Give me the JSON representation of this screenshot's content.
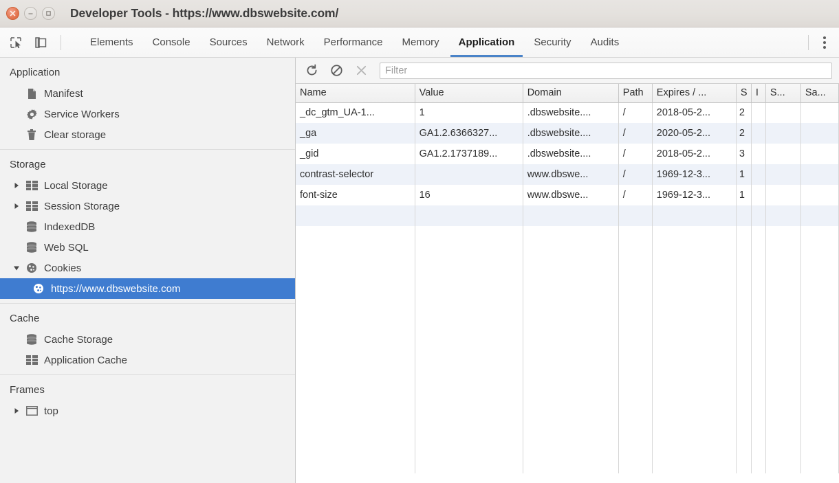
{
  "window": {
    "title": "Developer Tools - https://www.dbswebsite.com/",
    "buttons": {
      "close": "close-window",
      "minimize": "minimize-window",
      "maximize": "maximize-window"
    }
  },
  "devtools": {
    "tool_icons": [
      {
        "name": "inspect-element-icon",
        "title": "Inspect element"
      },
      {
        "name": "device-toolbar-icon",
        "title": "Toggle device toolbar"
      }
    ],
    "tabs": [
      {
        "label": "Elements",
        "active": false
      },
      {
        "label": "Console",
        "active": false
      },
      {
        "label": "Sources",
        "active": false
      },
      {
        "label": "Network",
        "active": false
      },
      {
        "label": "Performance",
        "active": false
      },
      {
        "label": "Memory",
        "active": false
      },
      {
        "label": "Application",
        "active": true
      },
      {
        "label": "Security",
        "active": false
      },
      {
        "label": "Audits",
        "active": false
      }
    ],
    "more_menu": "more-options",
    "accent_color": "#4a83c8",
    "selection_color": "#3f7cd0"
  },
  "sidebar": {
    "sections": [
      {
        "title": "Application",
        "items": [
          {
            "label": "Manifest",
            "icon": "document-icon",
            "arrow": "none",
            "selected": false
          },
          {
            "label": "Service Workers",
            "icon": "gear-icon",
            "arrow": "none",
            "selected": false
          },
          {
            "label": "Clear storage",
            "icon": "trash-icon",
            "arrow": "none",
            "selected": false
          }
        ]
      },
      {
        "title": "Storage",
        "items": [
          {
            "label": "Local Storage",
            "icon": "table-icon",
            "arrow": "collapsed",
            "selected": false
          },
          {
            "label": "Session Storage",
            "icon": "table-icon",
            "arrow": "collapsed",
            "selected": false
          },
          {
            "label": "IndexedDB",
            "icon": "database-icon",
            "arrow": "none",
            "selected": false
          },
          {
            "label": "Web SQL",
            "icon": "database-icon",
            "arrow": "none",
            "selected": false
          },
          {
            "label": "Cookies",
            "icon": "cookie-icon",
            "arrow": "expanded",
            "selected": false
          },
          {
            "label": "https://www.dbswebsite.com",
            "icon": "cookie-icon",
            "arrow": "none",
            "selected": true,
            "child": true
          }
        ]
      },
      {
        "title": "Cache",
        "items": [
          {
            "label": "Cache Storage",
            "icon": "database-icon",
            "arrow": "none",
            "selected": false
          },
          {
            "label": "Application Cache",
            "icon": "table-icon",
            "arrow": "none",
            "selected": false
          }
        ]
      },
      {
        "title": "Frames",
        "items": [
          {
            "label": "top",
            "icon": "frame-icon",
            "arrow": "collapsed",
            "selected": false
          }
        ]
      }
    ]
  },
  "pane": {
    "toolbar": {
      "refresh": "refresh-icon",
      "clear": "clear-icon",
      "delete": "delete-selected-icon",
      "filter_placeholder": "Filter",
      "filter_value": ""
    },
    "table": {
      "columns": [
        "Name",
        "Value",
        "Domain",
        "Path",
        "Expires / ...",
        "S",
        "I",
        "S...",
        "Sa..."
      ],
      "rows": [
        {
          "name": "_dc_gtm_UA-1...",
          "value": "1",
          "domain": ".dbswebsite....",
          "path": "/",
          "expires": "2018-05-2...",
          "size": "2",
          "httponly": "",
          "secure": "",
          "samesite": ""
        },
        {
          "name": "_ga",
          "value": "GA1.2.6366327...",
          "domain": ".dbswebsite....",
          "path": "/",
          "expires": "2020-05-2...",
          "size": "2",
          "httponly": "",
          "secure": "",
          "samesite": ""
        },
        {
          "name": "_gid",
          "value": "GA1.2.1737189...",
          "domain": ".dbswebsite....",
          "path": "/",
          "expires": "2018-05-2...",
          "size": "3",
          "httponly": "",
          "secure": "",
          "samesite": ""
        },
        {
          "name": "contrast-selector",
          "value": "",
          "domain": "www.dbswe...",
          "path": "/",
          "expires": "1969-12-3...",
          "size": "1",
          "httponly": "",
          "secure": "",
          "samesite": ""
        },
        {
          "name": "font-size",
          "value": "16",
          "domain": "www.dbswe...",
          "path": "/",
          "expires": "1969-12-3...",
          "size": "1",
          "httponly": "",
          "secure": "",
          "samesite": ""
        }
      ]
    }
  }
}
